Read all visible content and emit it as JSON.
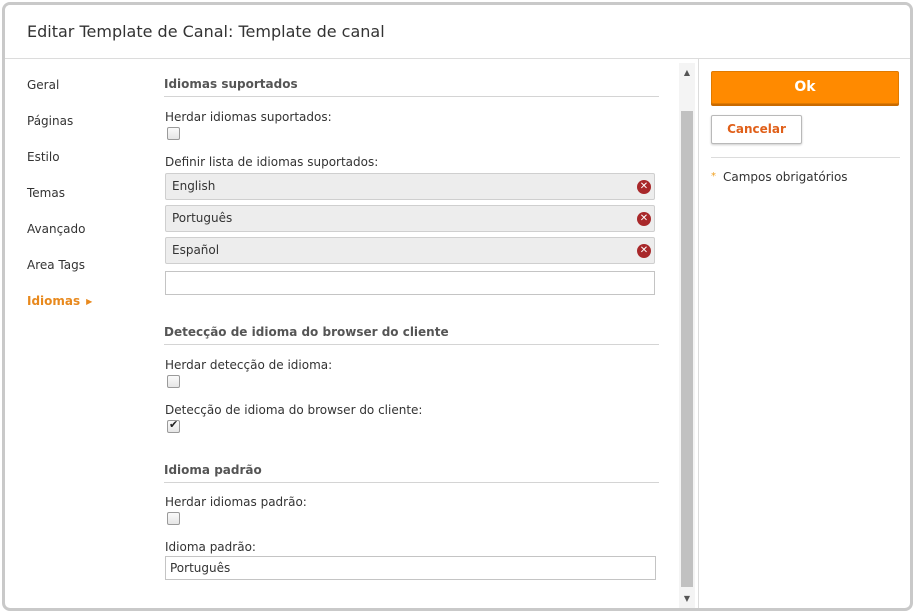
{
  "dialog": {
    "title": "Editar Template de Canal: Template de canal"
  },
  "nav": {
    "items": [
      {
        "label": "Geral"
      },
      {
        "label": "Páginas"
      },
      {
        "label": "Estilo"
      },
      {
        "label": "Temas"
      },
      {
        "label": "Avançado"
      },
      {
        "label": "Area Tags"
      },
      {
        "label": "Idiomas",
        "active": true
      }
    ]
  },
  "supported_languages": {
    "section_title": "Idiomas suportados",
    "inherit_label": "Herdar idiomas suportados:",
    "inherit_checked": false,
    "define_label": "Definir lista de idiomas suportados:",
    "languages": [
      {
        "label": "English"
      },
      {
        "label": "Português"
      },
      {
        "label": "Español"
      }
    ],
    "new_value": ""
  },
  "browser_detection": {
    "section_title": "Detecção de idioma do browser do cliente",
    "inherit_label": "Herdar detecção de idioma:",
    "inherit_checked": false,
    "detect_label": "Detecção de idioma do browser do cliente:",
    "detect_checked": true
  },
  "default_language": {
    "section_title": "Idioma padrão",
    "inherit_label": "Herdar idiomas padrão:",
    "inherit_checked": false,
    "value_label": "Idioma padrão:",
    "value": "Português"
  },
  "actions": {
    "ok_label": "Ok",
    "cancel_label": "Cancelar",
    "required_note": "Campos obrigatórios"
  },
  "colors": {
    "accent": "#ff8a00",
    "active_nav": "#e8891d",
    "remove_icon": "#a8282a"
  }
}
